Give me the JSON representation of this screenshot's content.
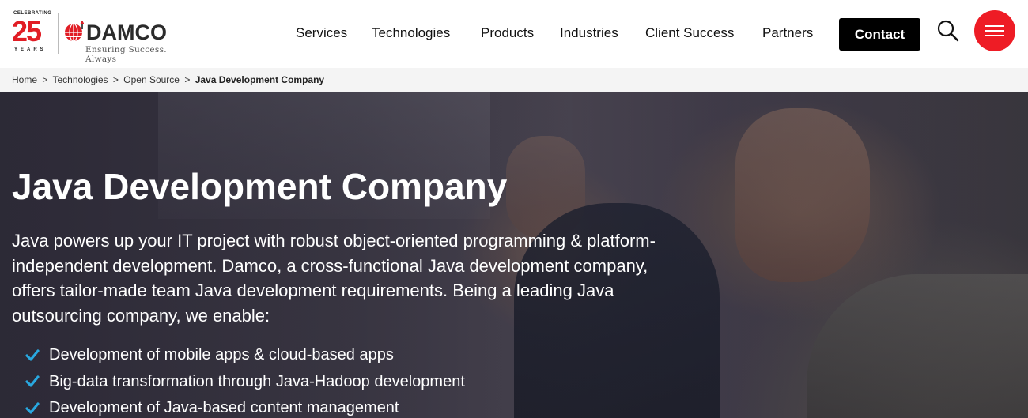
{
  "logo": {
    "celebrating": "CELEBRATING",
    "anniversary": "25",
    "years": "YEARS",
    "brand": "DAMCO",
    "tagline": "Ensuring Success. Always"
  },
  "nav": {
    "items": [
      {
        "label": "Services"
      },
      {
        "label": "Technologies"
      },
      {
        "label": "Products"
      },
      {
        "label": "Industries"
      },
      {
        "label": "Client Success"
      },
      {
        "label": "Partners"
      }
    ],
    "contact_label": "Contact"
  },
  "breadcrumb": {
    "items": [
      {
        "label": "Home"
      },
      {
        "label": "Technologies"
      },
      {
        "label": "Open Source"
      }
    ],
    "separator": ">",
    "current": "Java Development Company"
  },
  "hero": {
    "title": "Java Development Company",
    "description": "Java powers up your IT project with robust object-oriented programming & platform-independent development. Damco, a cross-functional Java development company, offers tailor-made team Java development requirements. Being a leading Java outsourcing company, we enable:",
    "bullets": [
      {
        "text": "Development of mobile apps & cloud-based apps"
      },
      {
        "text": "Big-data transformation through Java-Hadoop development"
      },
      {
        "text": "Development of Java-based content management"
      }
    ]
  },
  "colors": {
    "brand_red": "#ee1c25",
    "check_blue": "#29a8e0",
    "contact_bg": "#000000"
  }
}
